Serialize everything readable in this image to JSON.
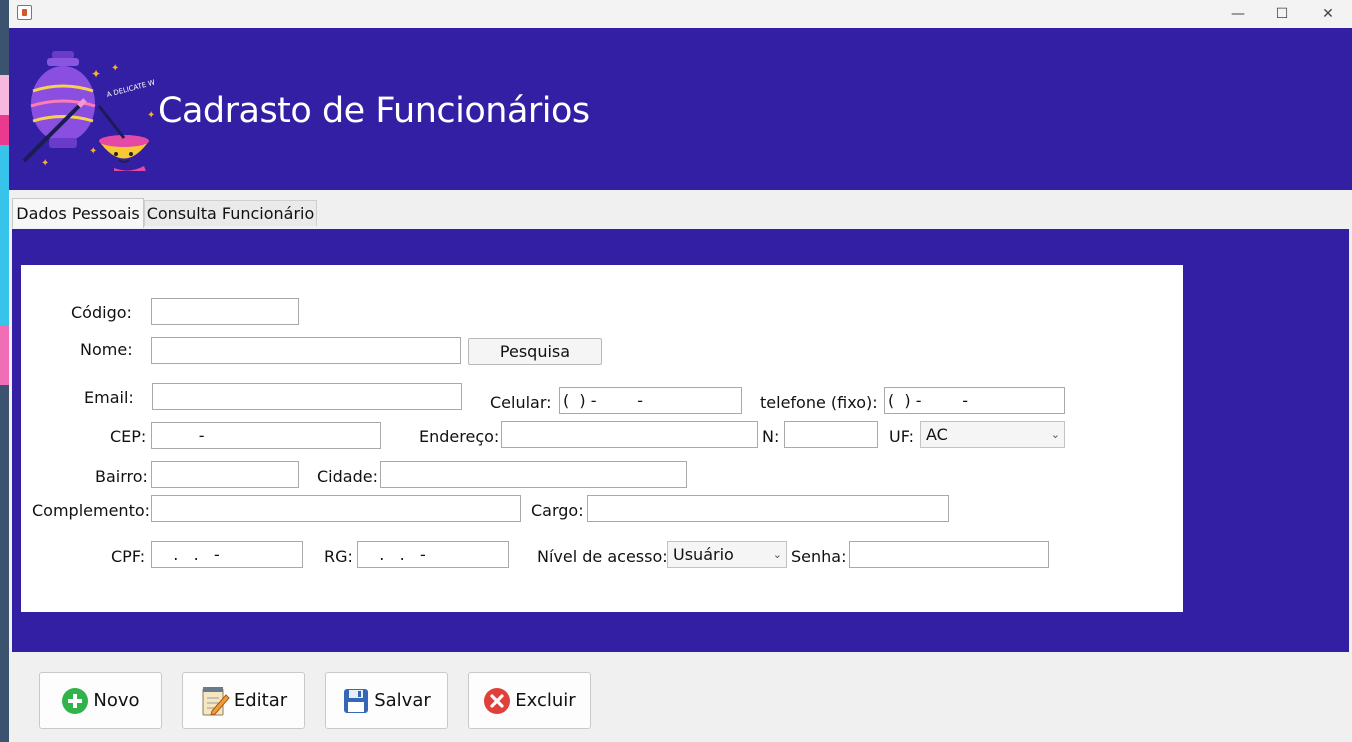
{
  "window": {
    "title": "",
    "minimize_glyph": "—",
    "maximize_glyph": "☐",
    "close_glyph": "✕"
  },
  "header": {
    "title": "Cadrasto de Funcionários",
    "logo_text": "A DELICATE WORK!"
  },
  "tabs": [
    {
      "label": "Dados Pessoais",
      "active": true
    },
    {
      "label": "Consulta Funcionário",
      "active": false
    }
  ],
  "form": {
    "codigo": {
      "label": "Código:",
      "value": ""
    },
    "nome": {
      "label": "Nome:",
      "value": ""
    },
    "pesquisa_button": "Pesquisa",
    "email": {
      "label": "Email:",
      "value": ""
    },
    "celular": {
      "label": "Celular:",
      "value": "(  ) -        -"
    },
    "telefone": {
      "label": "telefone (fixo):",
      "value": "(  ) -        -"
    },
    "cep": {
      "label": "CEP:",
      "value": "        -"
    },
    "endereco": {
      "label": "Endereço:",
      "value": ""
    },
    "numero": {
      "label": "N:",
      "value": ""
    },
    "uf": {
      "label": "UF:",
      "value": "AC"
    },
    "bairro": {
      "label": "Bairro:",
      "value": ""
    },
    "cidade": {
      "label": "Cidade:",
      "value": ""
    },
    "complemento": {
      "label": "Complemento:",
      "value": ""
    },
    "cargo": {
      "label": "Cargo:",
      "value": ""
    },
    "cpf": {
      "label": "CPF:",
      "value": "   .   .   -"
    },
    "rg": {
      "label": "RG:",
      "value": "   .   .   -"
    },
    "nivel": {
      "label": "Nível de acesso:",
      "value": "Usuário"
    },
    "senha": {
      "label": "Senha:",
      "value": ""
    }
  },
  "toolbar": {
    "novo": {
      "label": "Novo",
      "icon": "plus-circle-icon",
      "color": "#2fb34a"
    },
    "editar": {
      "label": "Editar",
      "icon": "notepad-pencil-icon"
    },
    "salvar": {
      "label": "Salvar",
      "icon": "floppy-disk-icon",
      "color": "#3467b5"
    },
    "excluir": {
      "label": "Excluir",
      "icon": "close-circle-icon",
      "color": "#e0403a"
    }
  },
  "colors": {
    "header_bg": "#331fa3",
    "panel_bg": "#331fa3"
  }
}
